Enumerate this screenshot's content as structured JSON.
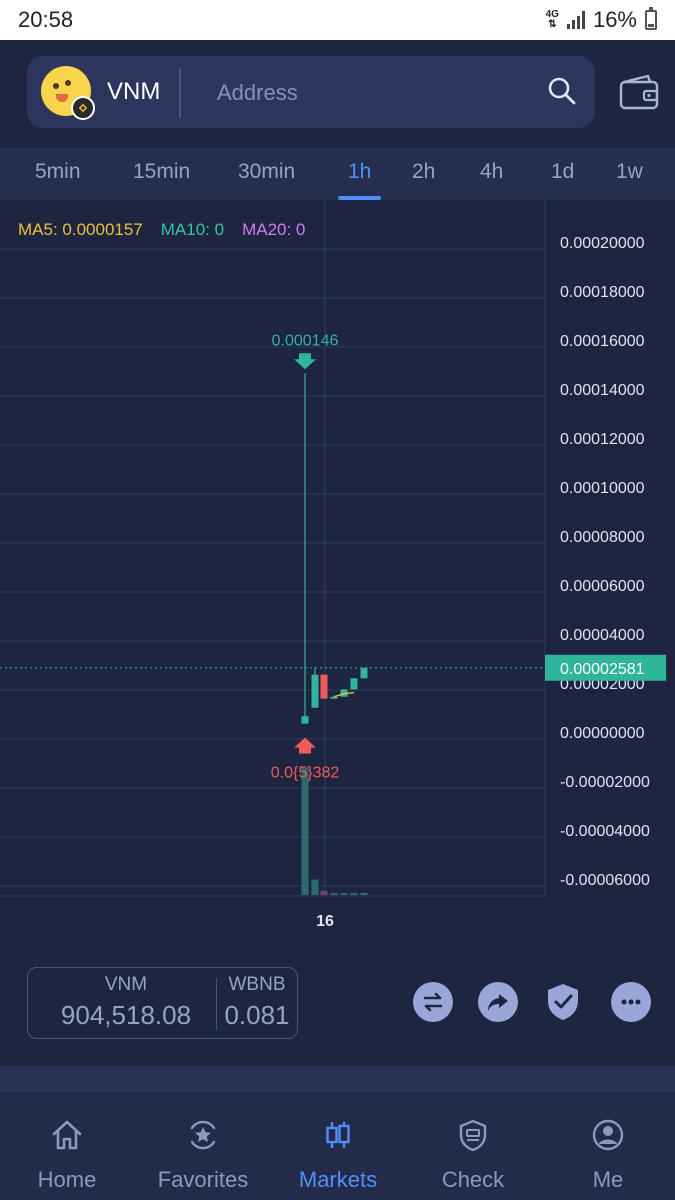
{
  "status_bar": {
    "time": "20:58",
    "network": "4G",
    "battery": "16%"
  },
  "header": {
    "token_symbol": "VNM",
    "address_placeholder": "Address",
    "icons": [
      "token-avatar-icon",
      "bnb-chain-icon",
      "search-icon",
      "wallet-icon"
    ]
  },
  "tabs": {
    "items": [
      "5min",
      "15min",
      "30min",
      "1h",
      "2h",
      "4h",
      "1d",
      "1w"
    ],
    "active": "1h"
  },
  "chart": {
    "ma_legend": {
      "ma5": "MA5: 0.0000157",
      "ma10": "MA10: 0",
      "ma20": "MA20: 0"
    },
    "high_label": "0.000146",
    "low_label": "0.0{5}382",
    "current_price": "0.00002581",
    "x_label": "16",
    "y_ticks": [
      "0.00020000",
      "0.00018000",
      "0.00016000",
      "0.00014000",
      "0.00012000",
      "0.00010000",
      "0.00008000",
      "0.00006000",
      "0.00004000",
      "0.00002000",
      "0.00000000",
      "-0.00002000",
      "-0.00004000",
      "-0.00006000"
    ],
    "colors": {
      "up": "#2fb59a",
      "down": "#ef5a5a",
      "grid": "#303a5f",
      "ma5": "#e8c23a"
    }
  },
  "chart_data": {
    "type": "candlestick",
    "xlabel": "",
    "ylabel": "",
    "ylim": [
      -6.8e-05,
      0.000205
    ],
    "x_tick": "16",
    "candles": [
      {
        "open": 3e-06,
        "high": 0.000146,
        "low": 3e-06,
        "close": 6e-06,
        "volume": 0.91
      },
      {
        "open": 9.5e-06,
        "high": 2.6e-05,
        "low": 9.5e-06,
        "close": 2.3e-05,
        "volume": 0.11
      },
      {
        "open": 2.3e-05,
        "high": 2.3e-05,
        "low": 1.32e-05,
        "close": 1.32e-05,
        "volume": 0.03
      },
      {
        "open": 1.32e-05,
        "high": 1.4e-05,
        "low": 1.32e-05,
        "close": 1.4e-05,
        "volume": 0.01
      },
      {
        "open": 1.4e-05,
        "high": 1.7e-05,
        "low": 1.4e-05,
        "close": 1.7e-05,
        "volume": 0.01
      },
      {
        "open": 1.7e-05,
        "high": 2.15e-05,
        "low": 1.7e-05,
        "close": 2.15e-05,
        "volume": 0.01
      },
      {
        "open": 2.15e-05,
        "high": 2.58e-05,
        "low": 2.15e-05,
        "close": 2.58e-05,
        "volume": 0.01
      }
    ],
    "ma5_line": [
      null,
      null,
      null,
      1.4e-05,
      1.52e-05,
      1.57e-05,
      null
    ],
    "current_price": 2.581e-05,
    "high": 0.000146,
    "low_text": "0.0{5}382"
  },
  "balance": {
    "token_a_label": "VNM",
    "token_a_value": "904,518.08",
    "token_b_label": "WBNB",
    "token_b_value": "0.081"
  },
  "actions": [
    "swap-icon",
    "share-icon",
    "shield-check-icon",
    "chat-icon"
  ],
  "bottom_nav": {
    "items": [
      {
        "label": "Home",
        "icon": "home-icon"
      },
      {
        "label": "Favorites",
        "icon": "star-icon"
      },
      {
        "label": "Markets",
        "icon": "candles-icon"
      },
      {
        "label": "Check",
        "icon": "check-shield-icon"
      },
      {
        "label": "Me",
        "icon": "user-icon"
      }
    ],
    "active": "Markets"
  }
}
